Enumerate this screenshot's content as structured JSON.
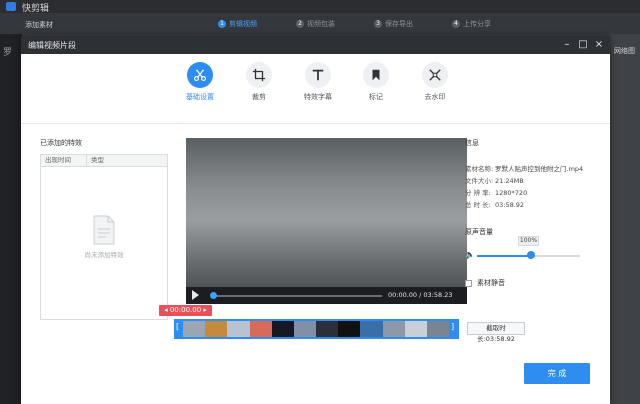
{
  "app": {
    "title": "快剪辑",
    "add_material": "添加素材",
    "left_label": "罗",
    "right_label": "网络图",
    "steps": [
      {
        "num": "1",
        "label": "剪辑视频"
      },
      {
        "num": "2",
        "label": "视频包装"
      },
      {
        "num": "3",
        "label": "保存导出"
      },
      {
        "num": "4",
        "label": "上传分享"
      }
    ]
  },
  "dialog": {
    "title": "编辑视频片段",
    "tabs": [
      {
        "label": "基础设置",
        "icon": "scissors-icon",
        "active": true
      },
      {
        "label": "裁剪",
        "icon": "crop-icon",
        "active": false
      },
      {
        "label": "特效字幕",
        "icon": "text-icon",
        "active": false
      },
      {
        "label": "标记",
        "icon": "bookmark-icon",
        "active": false
      },
      {
        "label": "去水印",
        "icon": "watermark-remove-icon",
        "active": false
      }
    ],
    "effects": {
      "title": "已添加的特效",
      "col_time": "出现时间",
      "col_type": "类型",
      "empty": "尚未添加特效"
    },
    "player": {
      "time": "00:00.00 / 03:58.23",
      "current": "00:00.00",
      "progress": 0.0
    },
    "clip_length": "截取时长:03:58.92",
    "info": {
      "title": "信息",
      "rows": [
        {
          "k": "素材名称:",
          "v": "罗默人贴声控到他附之门.mp4"
        },
        {
          "k": "文件大小:",
          "v": "21.24MB"
        },
        {
          "k": "分 辨 率:",
          "v": "1280*720"
        },
        {
          "k": "总 时 长:",
          "v": "03:58.92"
        }
      ],
      "volume_title": "原声音量",
      "volume_value": "100%",
      "volume_level": 0.52,
      "mute_label": "素材静音"
    },
    "done_label": "完 成"
  },
  "colors": {
    "accent": "#2f8cf0",
    "red": "#e8505b"
  }
}
